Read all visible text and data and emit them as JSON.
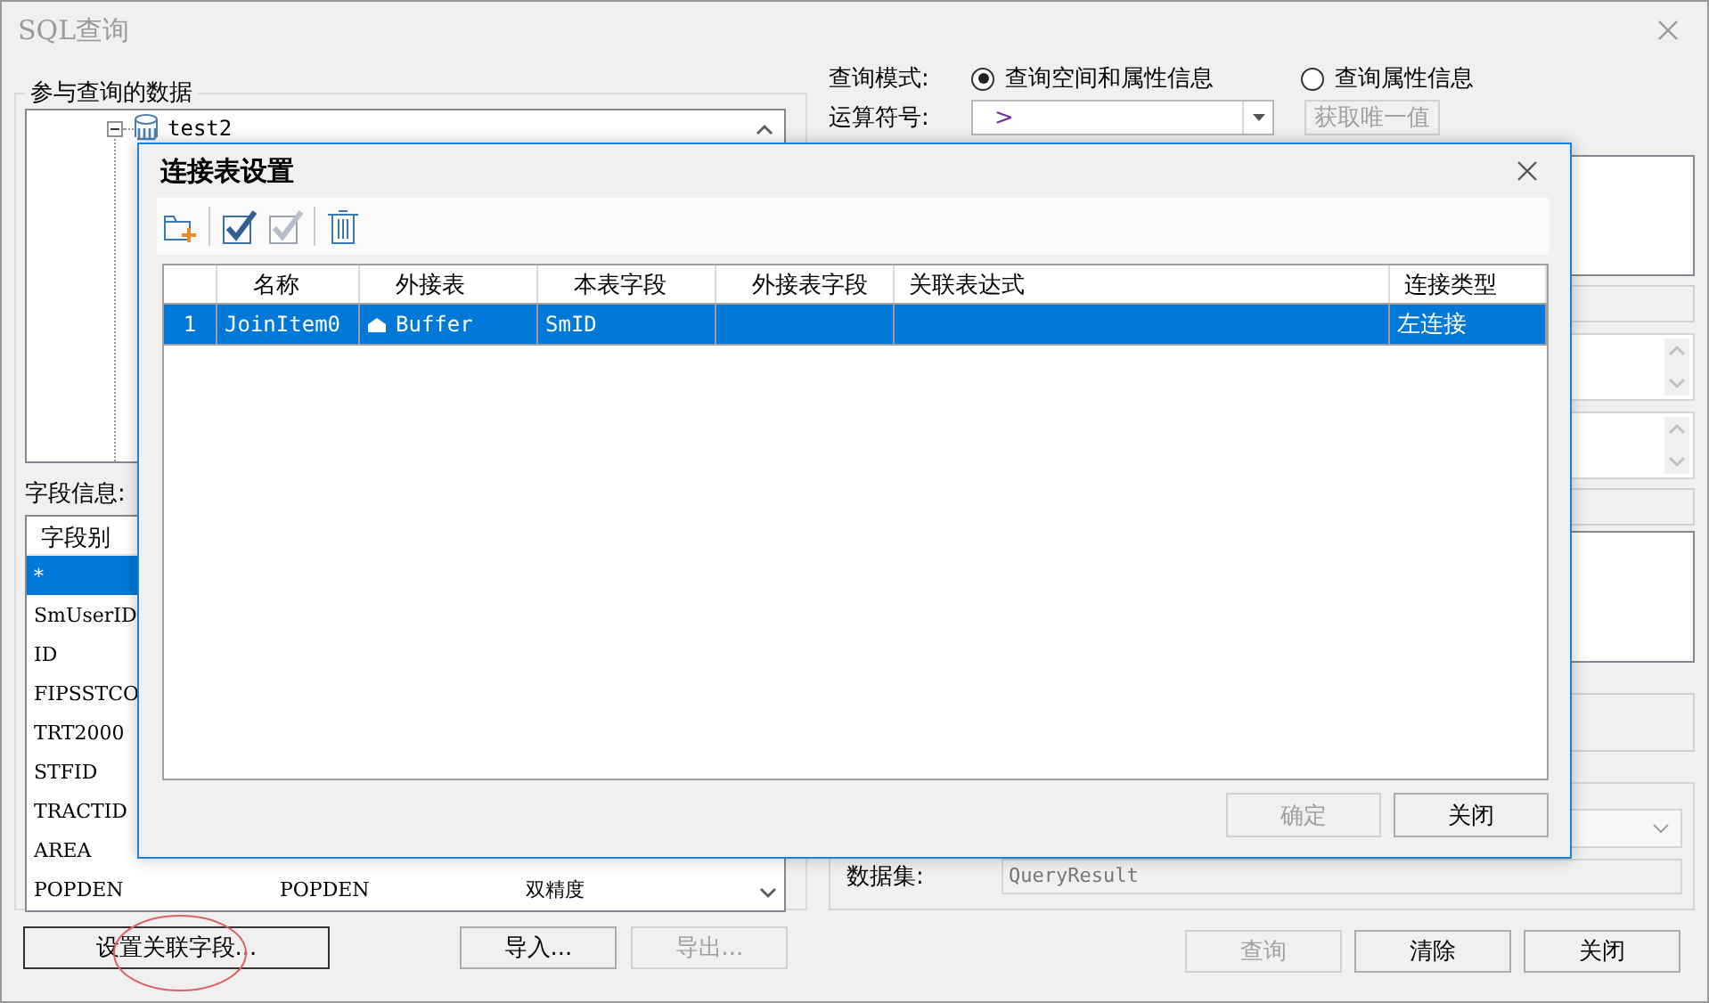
{
  "window": {
    "title": "SQL查询"
  },
  "data_group": {
    "title": "参与查询的数据",
    "tree": [
      {
        "label": "test2",
        "expanded": true
      }
    ]
  },
  "fields": {
    "label": "字段信息:",
    "columns": [
      "字段别"
    ],
    "rows": [
      {
        "cells": [
          "*"
        ],
        "selected": true
      },
      {
        "cells": [
          "SmUserID"
        ],
        "selected": false
      },
      {
        "cells": [
          "ID"
        ],
        "selected": false
      },
      {
        "cells": [
          "FIPSSTCO"
        ],
        "selected": false
      },
      {
        "cells": [
          "TRT2000"
        ],
        "selected": false
      },
      {
        "cells": [
          "STFID"
        ],
        "selected": false
      },
      {
        "cells": [
          "TRACTID"
        ],
        "selected": false
      },
      {
        "cells": [
          "AREA"
        ],
        "selected": false
      },
      {
        "cells": [
          "POPDEN",
          "POPDEN",
          "双精度"
        ],
        "selected": false
      }
    ]
  },
  "left_buttons": [
    {
      "label": "设置关联字段...",
      "disabled": false
    },
    {
      "label": "导入...",
      "disabled": false
    },
    {
      "label": "导出...",
      "disabled": true
    }
  ],
  "query": {
    "mode_label": "查询模式:",
    "modes": [
      {
        "label": "查询空间和属性信息",
        "selected": true
      },
      {
        "label": "查询属性信息",
        "selected": false
      }
    ],
    "operator_label": "运算符号:",
    "operator": ">",
    "unique_button": {
      "label": "获取唯一值",
      "disabled": true
    }
  },
  "output": {
    "dataset_label": "数据集:",
    "dataset": "QueryResult"
  },
  "bottom_buttons": [
    {
      "label": "查询",
      "disabled": true
    },
    {
      "label": "清除",
      "disabled": false
    },
    {
      "label": "关闭",
      "disabled": false
    }
  ],
  "dialog": {
    "title": "连接表设置",
    "toolbar": [
      {
        "kind": "add"
      },
      {
        "kind": "separator"
      },
      {
        "kind": "select-all"
      },
      {
        "kind": "unselect-all"
      },
      {
        "kind": "separator"
      },
      {
        "kind": "delete"
      }
    ],
    "columns": [
      {
        "label": "名称"
      },
      {
        "label": "外接表",
        "kind": "dataset"
      },
      {
        "label": "本表字段"
      },
      {
        "label": "外接表字段"
      },
      {
        "label": "关联表达式"
      },
      {
        "label": "连接类型"
      }
    ],
    "rows": [
      {
        "number": "1",
        "cells": [
          "JoinItem0",
          "Buffer",
          "SmID",
          null,
          null,
          "左连接"
        ],
        "selected": true
      }
    ],
    "buttons": [
      {
        "label": "确定",
        "disabled": true
      },
      {
        "label": "关闭",
        "disabled": false
      }
    ]
  }
}
